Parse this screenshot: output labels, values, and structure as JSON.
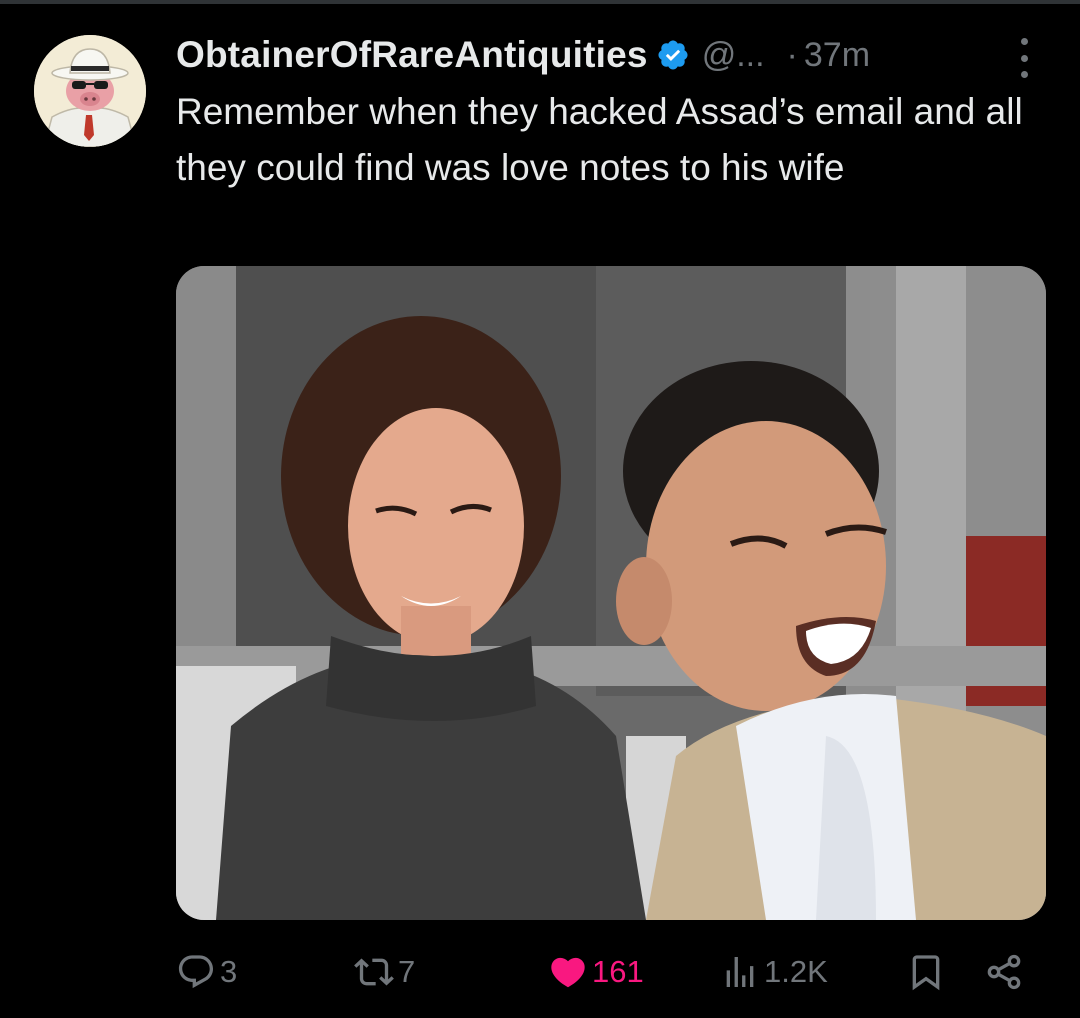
{
  "tweet": {
    "display_name": "ObtainerOfRareAntiquities",
    "handle": "@...",
    "separator": "·",
    "time": "37m",
    "text": "Remember when they hacked Assad’s email and all they could find was love notes to his wife",
    "media_alt": "Photo of a smiling woman with curly hair in a grey turtleneck next to a laughing man in a beige jacket"
  },
  "actions": {
    "replies": "3",
    "reposts": "7",
    "likes": "161",
    "views": "1.2K"
  },
  "colors": {
    "background": "#000000",
    "text": "#e7e9ea",
    "muted": "#71767b",
    "verified": "#1d9bf0",
    "like": "#f91880"
  },
  "icons": [
    "verified-badge-icon",
    "more-icon",
    "reply-icon",
    "repost-icon",
    "like-icon",
    "views-icon",
    "bookmark-icon",
    "share-icon"
  ]
}
